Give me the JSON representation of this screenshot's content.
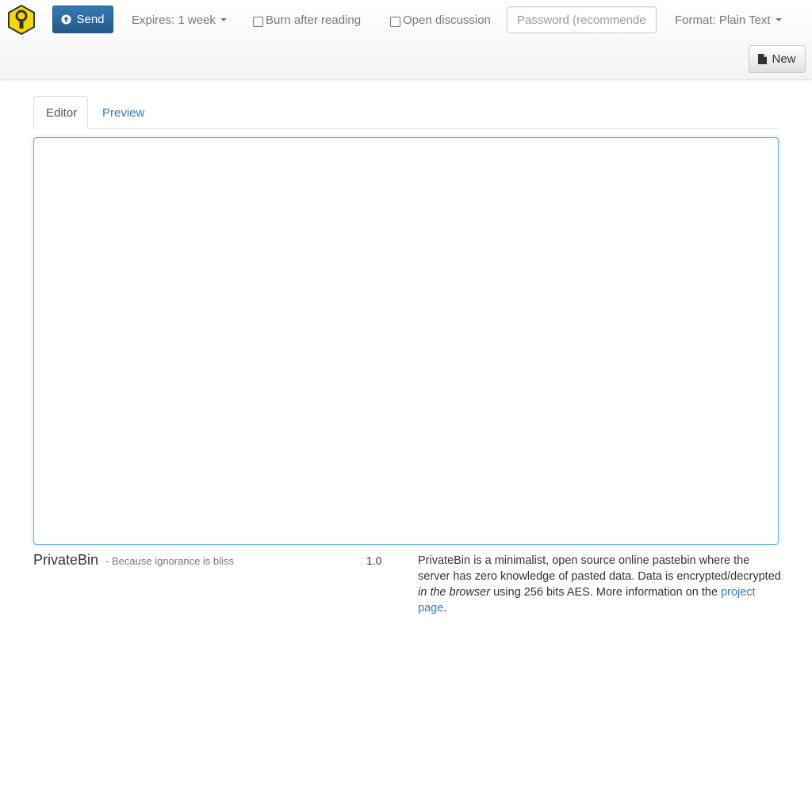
{
  "navbar": {
    "send_label": "Send",
    "expires_label": "Expires: 1 week",
    "burn_label": "Burn after reading",
    "discussion_label": "Open discussion",
    "password_placeholder": "Password (recommended",
    "format_label": "Format: Plain Text",
    "new_label": "New",
    "colors": {
      "logo_fill": "#f5d800",
      "send_bg": "#337ab7",
      "link": "#337ab7"
    }
  },
  "tabs": [
    {
      "label": "Editor",
      "active": true
    },
    {
      "label": "Preview",
      "active": false
    }
  ],
  "editor": {
    "value": ""
  },
  "footer": {
    "brand": "PrivateBin",
    "tagline": "- Because ignorance is bliss",
    "version": "1.0",
    "about_part1": "PrivateBin is a minimalist, open source online pastebin where the server has zero knowledge of pasted data. Data is encrypted/decrypted ",
    "about_italic": "in the browser",
    "about_part2": " using 256 bits AES. More information on the ",
    "about_link": "project page",
    "about_end": "."
  }
}
